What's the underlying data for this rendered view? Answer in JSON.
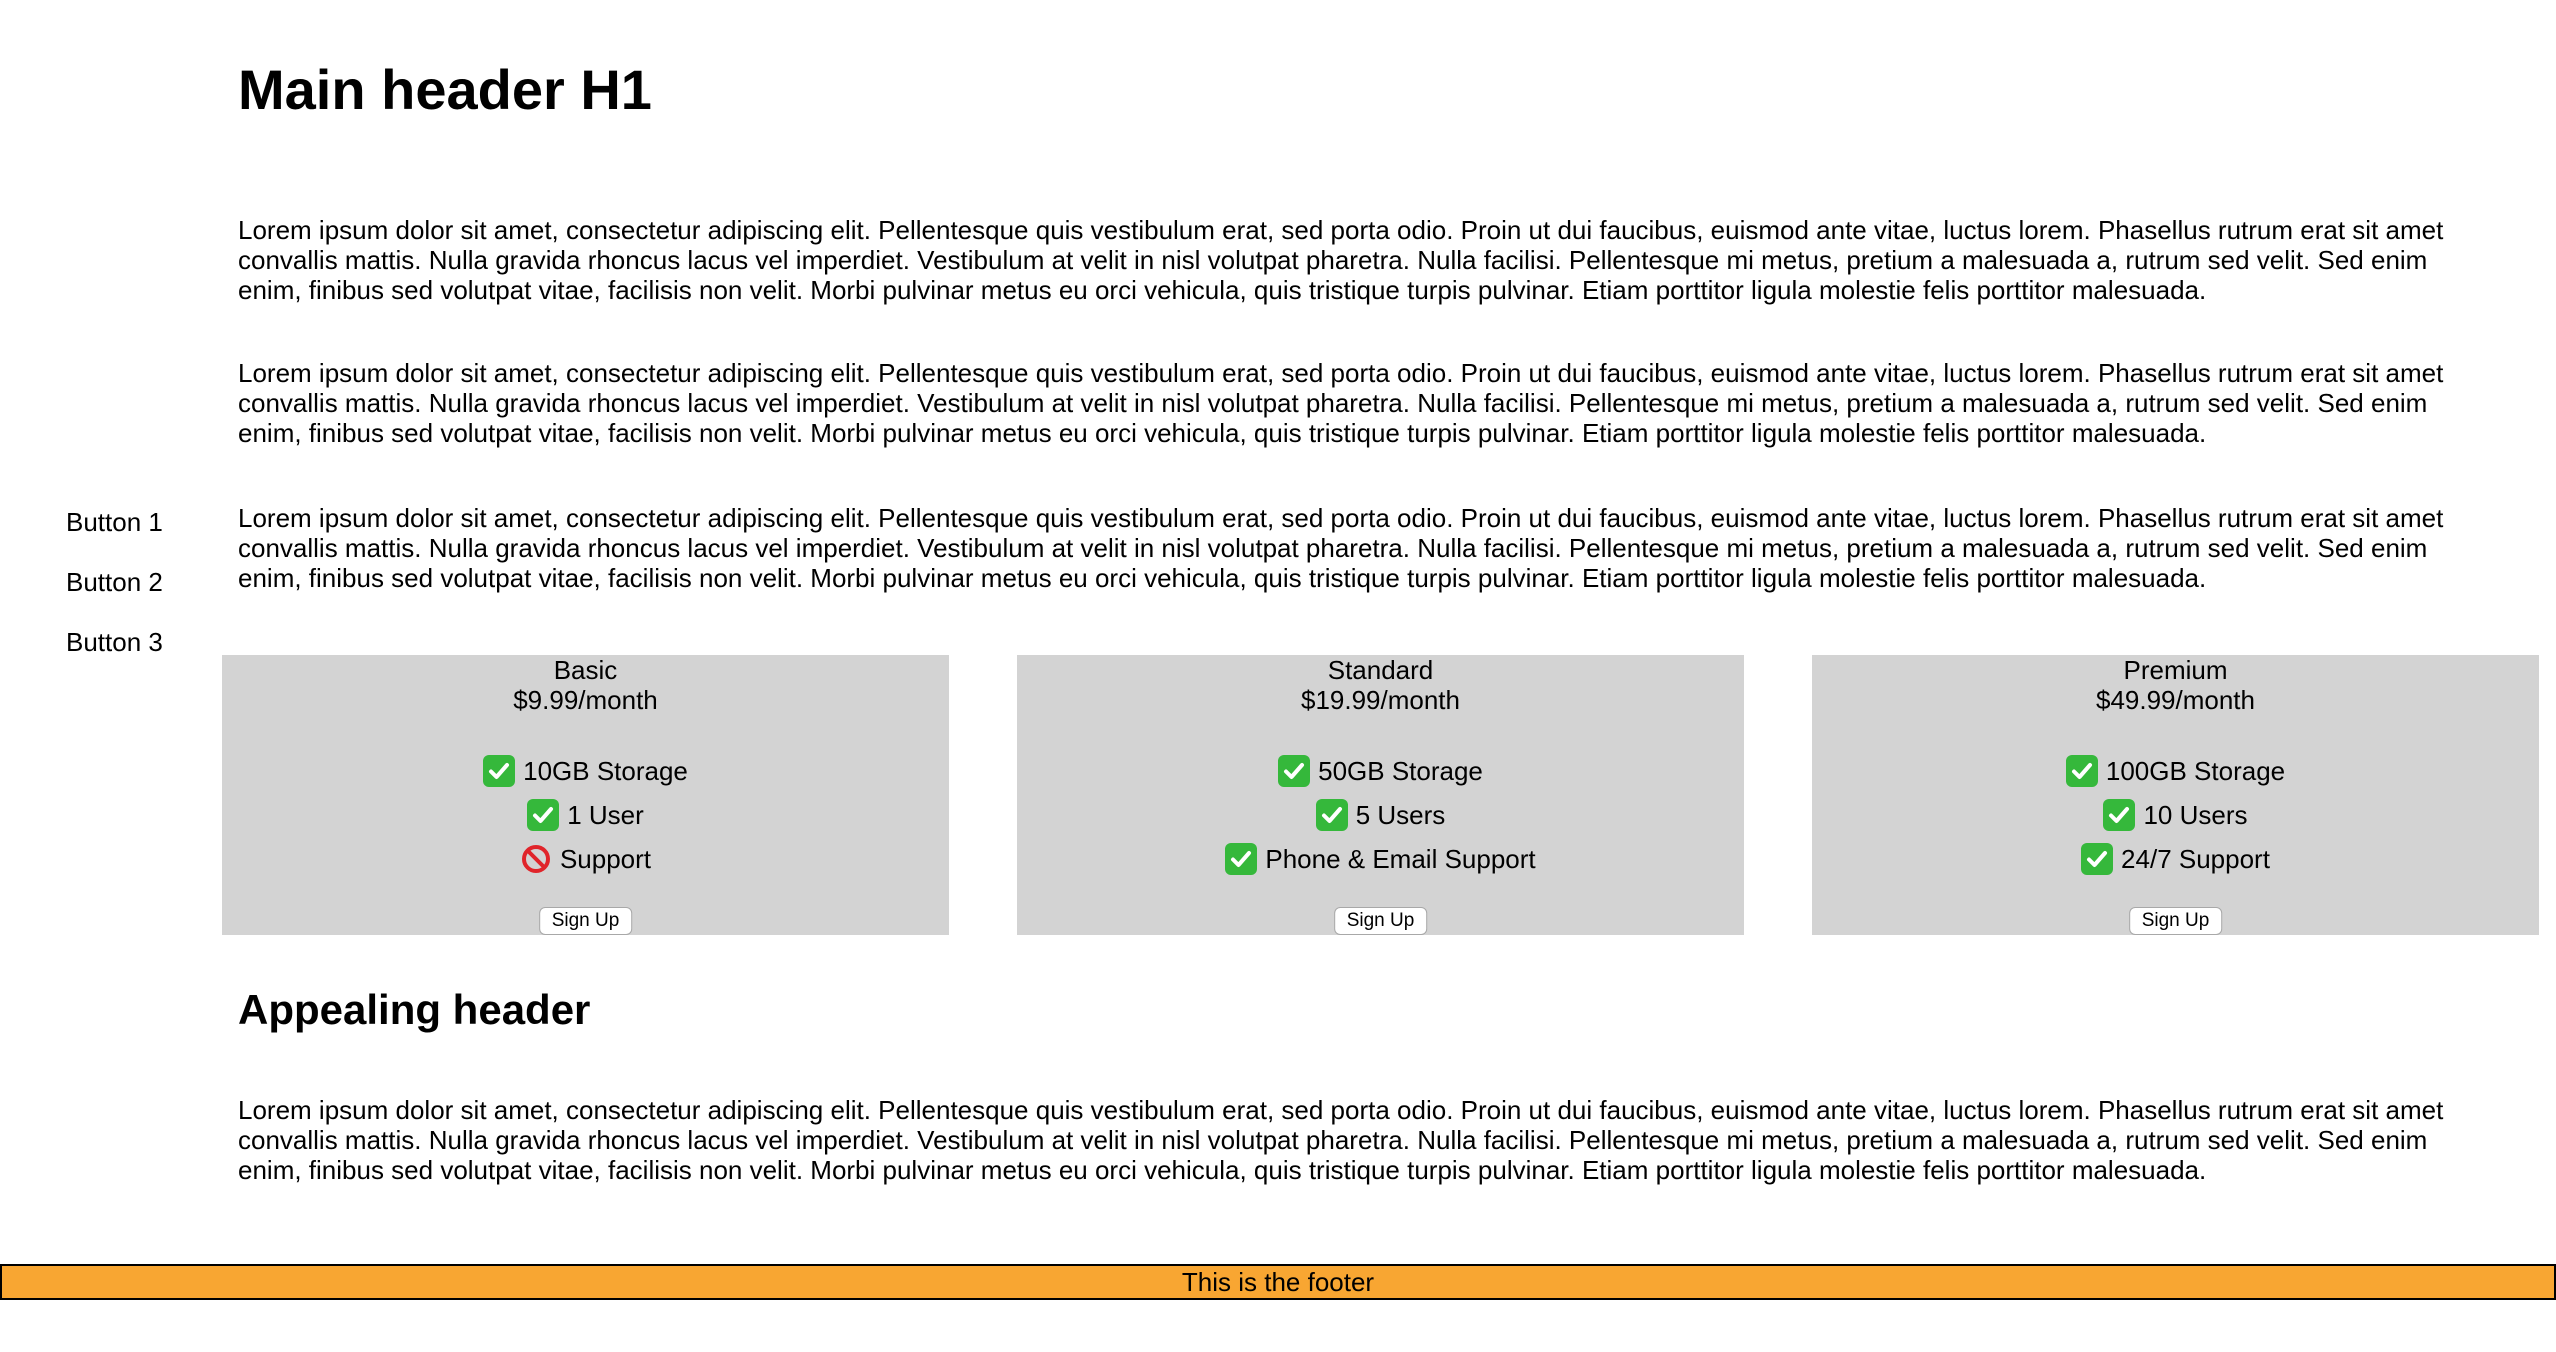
{
  "sidebar": {
    "buttons": [
      {
        "label": "Button 1"
      },
      {
        "label": "Button 2"
      },
      {
        "label": "Button 3"
      }
    ]
  },
  "main": {
    "title": "Main header H1",
    "paragraphs": [
      "Lorem ipsum dolor sit amet, consectetur adipiscing elit. Pellentesque quis vestibulum erat, sed porta odio. Proin ut dui faucibus, euismod ante vitae, luctus lorem. Phasellus rutrum erat sit amet convallis mattis. Nulla gravida rhoncus lacus vel imperdiet. Vestibulum at velit in nisl volutpat pharetra. Nulla facilisi. Pellentesque mi metus, pretium a malesuada a, rutrum sed velit. Sed enim enim, finibus sed volutpat vitae, facilisis non velit. Morbi pulvinar metus eu orci vehicula, quis tristique turpis pulvinar. Etiam porttitor ligula molestie felis porttitor malesuada.",
      "Lorem ipsum dolor sit amet, consectetur adipiscing elit. Pellentesque quis vestibulum erat, sed porta odio. Proin ut dui faucibus, euismod ante vitae, luctus lorem. Phasellus rutrum erat sit amet convallis mattis. Nulla gravida rhoncus lacus vel imperdiet. Vestibulum at velit in nisl volutpat pharetra. Nulla facilisi. Pellentesque mi metus, pretium a malesuada a, rutrum sed velit. Sed enim enim, finibus sed volutpat vitae, facilisis non velit. Morbi pulvinar metus eu orci vehicula, quis tristique turpis pulvinar. Etiam porttitor ligula molestie felis porttitor malesuada.",
      "Lorem ipsum dolor sit amet, consectetur adipiscing elit. Pellentesque quis vestibulum erat, sed porta odio. Proin ut dui faucibus, euismod ante vitae, luctus lorem. Phasellus rutrum erat sit amet convallis mattis. Nulla gravida rhoncus lacus vel imperdiet. Vestibulum at velit in nisl volutpat pharetra. Nulla facilisi. Pellentesque mi metus, pretium a malesuada a, rutrum sed velit. Sed enim enim, finibus sed volutpat vitae, facilisis non velit. Morbi pulvinar metus eu orci vehicula, quis tristique turpis pulvinar. Etiam porttitor ligula molestie felis porttitor malesuada."
    ],
    "subheading": "Appealing header",
    "closing_paragraph": "Lorem ipsum dolor sit amet, consectetur adipiscing elit. Pellentesque quis vestibulum erat, sed porta odio. Proin ut dui faucibus, euismod ante vitae, luctus lorem. Phasellus rutrum erat sit amet convallis mattis. Nulla gravida rhoncus lacus vel imperdiet. Vestibulum at velit in nisl volutpat pharetra. Nulla facilisi. Pellentesque mi metus, pretium a malesuada a, rutrum sed velit. Sed enim enim, finibus sed volutpat vitae, facilisis non velit. Morbi pulvinar metus eu orci vehicula, quis tristique turpis pulvinar. Etiam porttitor ligula molestie felis porttitor malesuada."
  },
  "plans": [
    {
      "name": "Basic",
      "price": "$9.99/month",
      "features": [
        {
          "text": "10GB Storage",
          "icon": "check-icon"
        },
        {
          "text": "1 User",
          "icon": "check-icon"
        },
        {
          "text": "Support",
          "icon": "no-entry-icon"
        }
      ],
      "cta": "Sign Up"
    },
    {
      "name": "Standard",
      "price": "$19.99/month",
      "features": [
        {
          "text": "50GB Storage",
          "icon": "check-icon"
        },
        {
          "text": "5 Users",
          "icon": "check-icon"
        },
        {
          "text": "Phone & Email Support",
          "icon": "check-icon"
        }
      ],
      "cta": "Sign Up"
    },
    {
      "name": "Premium",
      "price": "$49.99/month",
      "features": [
        {
          "text": "100GB Storage",
          "icon": "check-icon"
        },
        {
          "text": "10 Users",
          "icon": "check-icon"
        },
        {
          "text": "24/7 Support",
          "icon": "check-icon"
        }
      ],
      "cta": "Sign Up"
    }
  ],
  "footer": {
    "text": "This is the footer"
  },
  "colors": {
    "card_background": "#d3d3d3",
    "footer_background": "#f8a632",
    "check_green": "#35b83b",
    "no_entry_red": "#e0242a"
  }
}
